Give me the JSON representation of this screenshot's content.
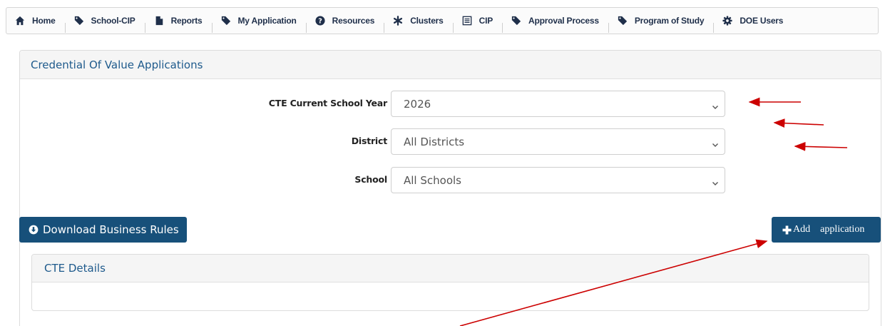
{
  "nav": {
    "items": [
      {
        "label": "Home",
        "icon": "home-icon"
      },
      {
        "label": "School-CIP",
        "icon": "tag-icon"
      },
      {
        "label": "Reports",
        "icon": "file-icon"
      },
      {
        "label": "My Application",
        "icon": "tag-icon"
      },
      {
        "label": "Resources",
        "icon": "question-circle-icon"
      },
      {
        "label": "Clusters",
        "icon": "asterisk-icon"
      },
      {
        "label": "CIP",
        "icon": "list-icon"
      },
      {
        "label": "Approval Process",
        "icon": "tag-icon"
      },
      {
        "label": "Program of Study",
        "icon": "tag-icon"
      },
      {
        "label": "DOE Users",
        "icon": "gear-icon"
      }
    ]
  },
  "panel": {
    "title": "Credential Of Value Applications"
  },
  "form": {
    "school_year": {
      "label": "CTE Current School Year",
      "value": "2026"
    },
    "district": {
      "label": "District",
      "value": "All Districts"
    },
    "school": {
      "label": "School",
      "value": "All Schools"
    }
  },
  "buttons": {
    "download_label": "Download Business Rules",
    "add_label_1": "Add",
    "add_label_2": "application"
  },
  "details": {
    "title": "CTE Details"
  },
  "colors": {
    "brand": "#17507a",
    "heading_text": "#1e5a8c",
    "annotation_red": "#cc0000"
  }
}
